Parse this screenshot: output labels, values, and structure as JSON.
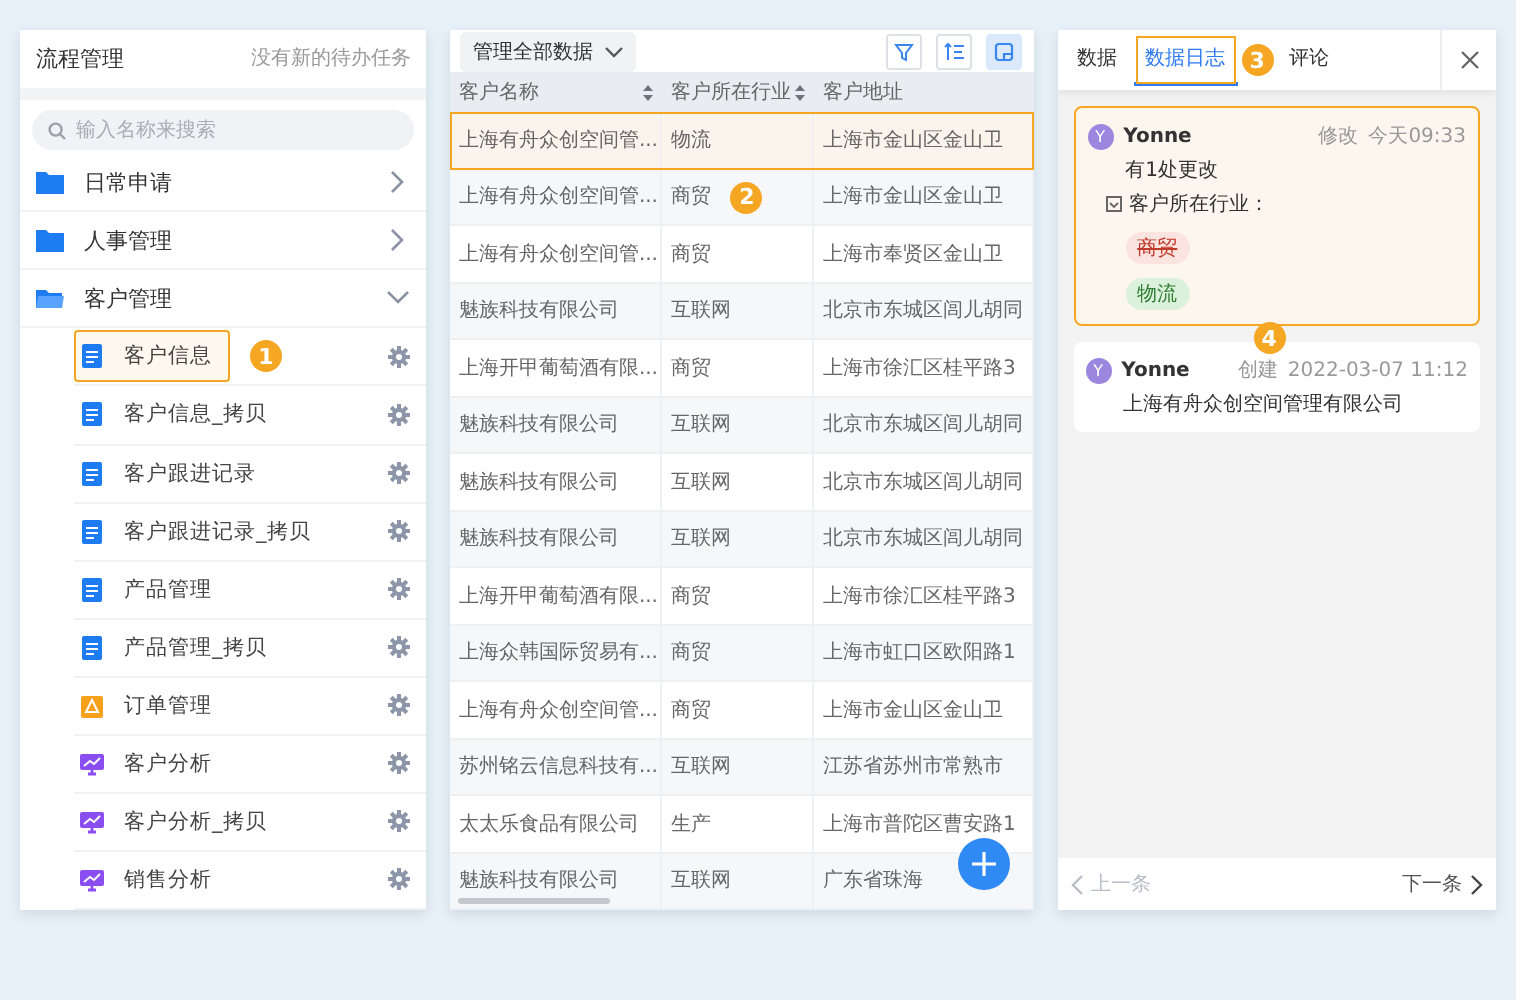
{
  "sidebar": {
    "title": "流程管理",
    "notice": "没有新的待办任务",
    "search": {
      "placeholder": "输入名称来搜索"
    },
    "groups": [
      {
        "label": "日常申请",
        "expanded": false
      },
      {
        "label": "人事管理",
        "expanded": false
      },
      {
        "label": "客户管理",
        "expanded": true,
        "children": [
          {
            "label": "客户信息",
            "kind": "form",
            "selected": true,
            "callout": "1"
          },
          {
            "label": "客户信息_拷贝",
            "kind": "form",
            "selected": false
          },
          {
            "label": "客户跟进记录",
            "kind": "form",
            "selected": false
          },
          {
            "label": "客户跟进记录_拷贝",
            "kind": "form",
            "selected": false
          },
          {
            "label": "产品管理",
            "kind": "form",
            "selected": false
          },
          {
            "label": "产品管理_拷贝",
            "kind": "form",
            "selected": false
          },
          {
            "label": "订单管理",
            "kind": "flow",
            "selected": false
          },
          {
            "label": "客户分析",
            "kind": "report",
            "selected": false
          },
          {
            "label": "客户分析_拷贝",
            "kind": "report",
            "selected": false
          },
          {
            "label": "销售分析",
            "kind": "report",
            "selected": false
          }
        ]
      }
    ]
  },
  "table": {
    "scope": "管理全部数据",
    "tools": [
      {
        "kind": "filter",
        "selected": false
      },
      {
        "kind": "sort",
        "selected": false
      },
      {
        "kind": "view",
        "selected": true
      }
    ],
    "columns": [
      {
        "label": "客户名称",
        "sortable": true
      },
      {
        "label": "客户所在行业",
        "sortable": true
      },
      {
        "label": "客户地址",
        "sortable": false
      }
    ],
    "rows": [
      {
        "cells": [
          "上海有舟众创空间管...",
          "物流",
          "上海市金山区金山卫"
        ],
        "selected": true
      },
      {
        "cells": [
          "上海有舟众创空间管...",
          "商贸",
          "上海市金山区金山卫"
        ],
        "selected": false,
        "callout": "2"
      },
      {
        "cells": [
          "上海有舟众创空间管...",
          "商贸",
          "上海市奉贤区金山卫"
        ],
        "selected": false
      },
      {
        "cells": [
          "魅族科技有限公司",
          "互联网",
          "北京市东城区闾儿胡同"
        ],
        "selected": false
      },
      {
        "cells": [
          "上海开甲葡萄酒有限...",
          "商贸",
          "上海市徐汇区桂平路3"
        ],
        "selected": false
      },
      {
        "cells": [
          "魅族科技有限公司",
          "互联网",
          "北京市东城区闾儿胡同"
        ],
        "selected": false
      },
      {
        "cells": [
          "魅族科技有限公司",
          "互联网",
          "北京市东城区闾儿胡同"
        ],
        "selected": false
      },
      {
        "cells": [
          "魅族科技有限公司",
          "互联网",
          "北京市东城区闾儿胡同"
        ],
        "selected": false
      },
      {
        "cells": [
          "上海开甲葡萄酒有限...",
          "商贸",
          "上海市徐汇区桂平路3"
        ],
        "selected": false
      },
      {
        "cells": [
          "上海众韩国际贸易有...",
          "商贸",
          "上海市虹口区欧阳路1"
        ],
        "selected": false
      },
      {
        "cells": [
          "上海有舟众创空间管...",
          "商贸",
          "上海市金山区金山卫"
        ],
        "selected": false
      },
      {
        "cells": [
          "苏州铭云信息科技有...",
          "互联网",
          "江苏省苏州市常熟市"
        ],
        "selected": false
      },
      {
        "cells": [
          "太太乐食品有限公司",
          "生产",
          "上海市普陀区曹安路1"
        ],
        "selected": false
      },
      {
        "cells": [
          "魅族科技有限公司",
          "互联网",
          "广东省珠海"
        ],
        "selected": false
      }
    ]
  },
  "detail": {
    "tabs": [
      {
        "label": "数据",
        "selected": false
      },
      {
        "label": "数据日志",
        "selected": true,
        "callout": "3"
      },
      {
        "label": "评论",
        "selected": false
      }
    ],
    "log": [
      {
        "avatar": "Y",
        "user": "Yonne",
        "action": "修改",
        "time": "今天09:33",
        "selected": true,
        "summary": "有1处更改",
        "field": "客户所在行业：",
        "tags": [
          {
            "label": "商贸",
            "kind": "old"
          },
          {
            "label": "物流",
            "kind": "new"
          }
        ]
      },
      {
        "avatar": "Y",
        "user": "Yonne",
        "action": "创建",
        "time": "2022-03-07 11:12",
        "selected": false,
        "callout": "4",
        "value": "上海有舟众创空间管理有限公司"
      }
    ],
    "prev": {
      "label": "上一条",
      "disabled": true
    },
    "next": {
      "label": "下一条",
      "disabled": false
    }
  }
}
